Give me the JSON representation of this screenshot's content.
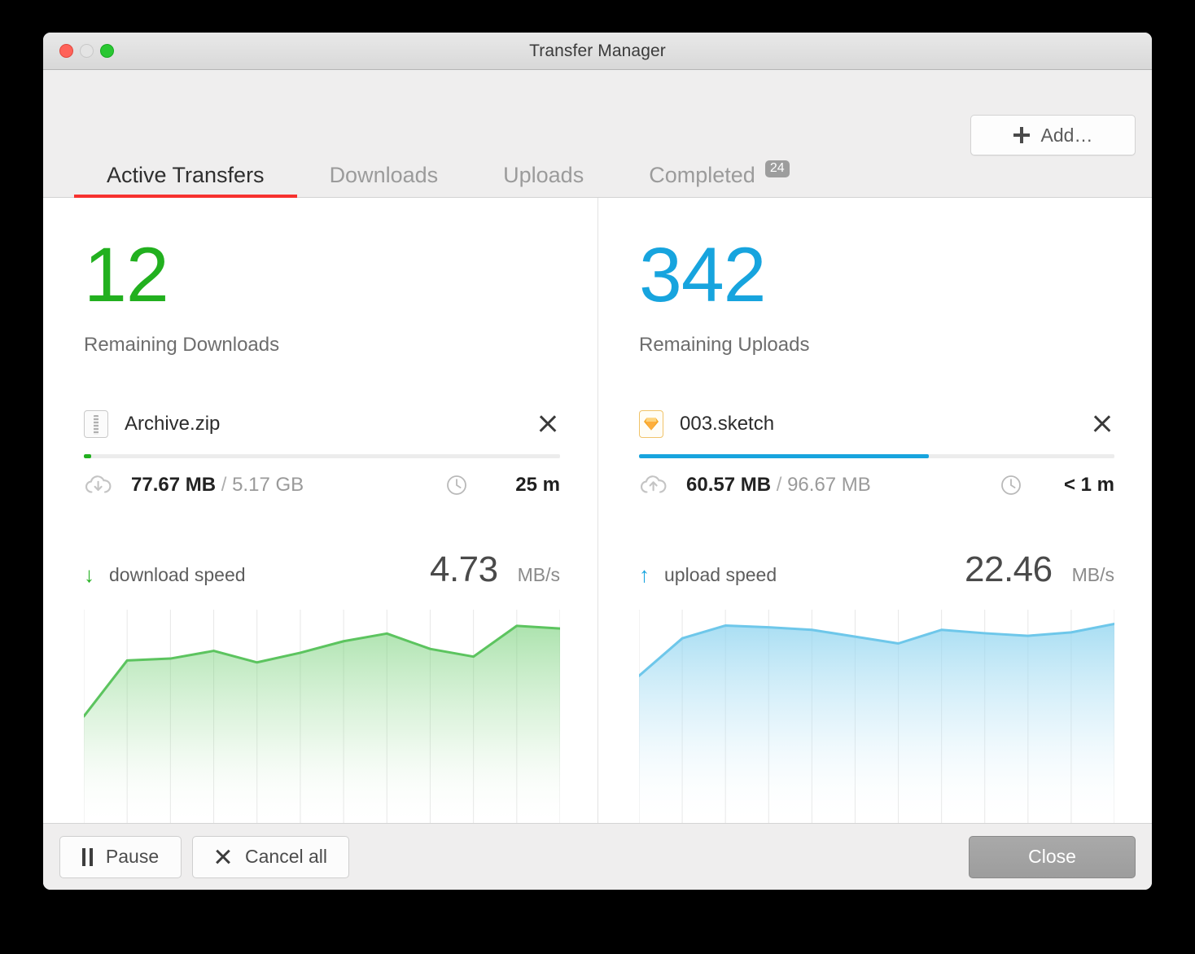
{
  "window": {
    "title": "Transfer Manager",
    "traffic_lights": [
      "close-button",
      "minimize-button",
      "zoom-button"
    ]
  },
  "toolbar": {
    "add_label": "Add…",
    "add_icon": "plus-icon"
  },
  "tabs": [
    {
      "label": "Active Transfers",
      "active": true,
      "badge": ""
    },
    {
      "label": "Downloads",
      "active": false,
      "badge": ""
    },
    {
      "label": "Uploads",
      "active": false,
      "badge": ""
    },
    {
      "label": "Completed",
      "active": false,
      "badge": "24"
    }
  ],
  "colors": {
    "download": "#22b01f",
    "upload": "#17a4de",
    "tab_underline": "#f7312e",
    "badge": "#9d9d9d"
  },
  "downloads": {
    "count": "12",
    "caption": "Remaining Downloads",
    "file": {
      "name": "Archive.zip",
      "icon": "zip-file-icon",
      "cancel_icon": "close-icon"
    },
    "progress_percent": 1.5,
    "transferred": "77.67 MB",
    "separator": "/",
    "total": "5.17 GB",
    "transfer_icon": "cloud-download-icon",
    "time_icon": "clock-icon",
    "eta": "25 m",
    "speed_arrow": "↓",
    "speed_label": "download speed",
    "speed_value": "4.73",
    "speed_unit": "MB/s"
  },
  "uploads": {
    "count": "342",
    "caption": "Remaining Uploads",
    "file": {
      "name": "003.sketch",
      "icon": "sketch-file-icon",
      "cancel_icon": "close-icon"
    },
    "progress_percent": 61,
    "transferred": "60.57 MB",
    "separator": "/",
    "total": "96.67 MB",
    "transfer_icon": "cloud-upload-icon",
    "time_icon": "clock-icon",
    "eta": "< 1 m",
    "speed_arrow": "↑",
    "speed_label": "upload speed",
    "speed_value": "22.46",
    "speed_unit": "MB/s"
  },
  "footer": {
    "pause_label": "Pause",
    "cancel_all_label": "Cancel all",
    "close_label": "Close"
  },
  "chart_data": [
    {
      "type": "area",
      "title": "download speed",
      "series_name": "Download speed",
      "unit": "MB/s",
      "color": "#66cc66",
      "x": [
        0,
        1,
        2,
        3,
        4,
        5,
        6,
        7,
        8,
        9,
        10,
        11
      ],
      "values": [
        2.6,
        4.05,
        4.1,
        4.3,
        4.0,
        4.25,
        4.55,
        4.75,
        4.35,
        4.15,
        4.95,
        4.88
      ],
      "current": 4.73,
      "ylim": [
        0,
        5.2
      ],
      "grid": true,
      "xlabel": "",
      "ylabel": "",
      "tick_labels": []
    },
    {
      "type": "area",
      "title": "upload speed",
      "series_name": "Upload speed",
      "unit": "MB/s",
      "color": "#86d1ef",
      "x": [
        0,
        1,
        2,
        3,
        4,
        5,
        6,
        7,
        8,
        9,
        10,
        11
      ],
      "values": [
        16.5,
        20.9,
        22.4,
        22.2,
        21.9,
        21.1,
        20.3,
        21.9,
        21.5,
        21.2,
        21.6,
        22.6
      ],
      "current": 22.46,
      "ylim": [
        0,
        23.5
      ],
      "grid": true,
      "xlabel": "",
      "ylabel": "",
      "tick_labels": []
    }
  ]
}
